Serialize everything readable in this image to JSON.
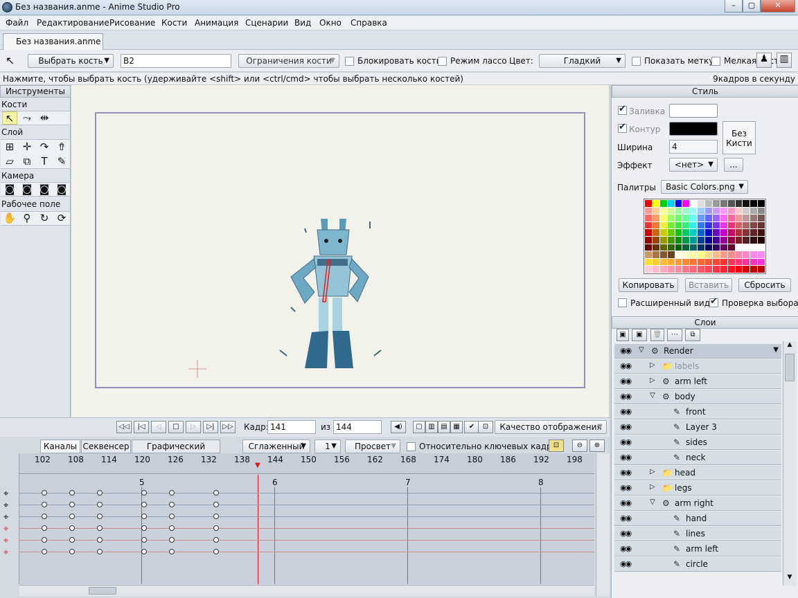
{
  "window": {
    "title": "Без названия.anme - Anime Studio Pro",
    "minimize_glyph": "–",
    "maximize_glyph": "▢",
    "close_glyph": "✕"
  },
  "menu": [
    "Файл",
    "Редактирование",
    "Рисование",
    "Кости",
    "Анимация",
    "Сценарии",
    "Вид",
    "Окно",
    "Справка"
  ],
  "document_tab": "Без названия.anme",
  "toolbar": {
    "mode_dropdown": "Выбрать кость",
    "bone_name": "B2",
    "constraints_button": "Ограничения кости",
    "lock_bone_label": "Блокировать кость",
    "lasso_label": "Режим лассо",
    "color_label": "Цвет:",
    "color_value": "Гладкий",
    "show_label_label": "Показать метку",
    "small_label": "Мелкая кость"
  },
  "status": {
    "hint": "Нажмите, чтобы выбрать кость (удерживайте <shift> или <ctrl/cmd> чтобы выбрать несколько костей)",
    "fps": "9кадров в секунду"
  },
  "tools": {
    "title": "Инструменты",
    "groups": [
      "Кости",
      "Слой",
      "Камера",
      "Рабочее поле"
    ]
  },
  "playback": {
    "frame_label": "Кадр:",
    "frame_value": "141",
    "of_label": "из",
    "total_frames": "144",
    "quality_dropdown": "Качество отображения"
  },
  "timeline": {
    "tabs": [
      "Каналы",
      "Секвенсер",
      "Графический режим"
    ],
    "interp_dropdown": "Сглаженный",
    "step_dropdown": "1",
    "onion_dropdown": "Просвет",
    "relative_label": "Относительно ключевых кадров",
    "ruler_ticks": [
      "102",
      "108",
      "114",
      "120",
      "126",
      "132",
      "138",
      "144",
      "150",
      "156",
      "162",
      "168",
      "174",
      "180",
      "186",
      "192",
      "198"
    ],
    "second_markers": [
      "5",
      "6",
      "7",
      "8"
    ],
    "current_frame": 141
  },
  "style": {
    "title": "Стиль",
    "fill_label": "Заливка",
    "stroke_label": "Контур",
    "no_brush_line1": "Без",
    "no_brush_line2": "Кисти",
    "width_label": "Ширина",
    "width_value": "4",
    "effect_label": "Эффект",
    "effect_value": "<нет>",
    "more_button": "...",
    "palettes_label": "Палитры",
    "palette_value": "Basic Colors.png",
    "copy_button": "Копировать",
    "paste_button": "Вставить",
    "reset_button": "Сбросить",
    "advanced_label": "Расширенный вид",
    "select_check_label": "Проверка выбора",
    "fill_color": "#ffffff",
    "stroke_color": "#000000"
  },
  "layers": {
    "title": "Слои",
    "rows": [
      {
        "name": "Render",
        "type": "bone",
        "indent": 0,
        "expanded": true,
        "head": true
      },
      {
        "name": "labels",
        "type": "folder",
        "indent": 1,
        "expanded": false,
        "dim": true
      },
      {
        "name": "arm left",
        "type": "bone",
        "indent": 1,
        "expanded": false
      },
      {
        "name": "body",
        "type": "bone",
        "indent": 1,
        "expanded": true
      },
      {
        "name": "front",
        "type": "vector",
        "indent": 2
      },
      {
        "name": "Layer 3",
        "type": "vector",
        "indent": 2
      },
      {
        "name": "sides",
        "type": "vector",
        "indent": 2
      },
      {
        "name": "neck",
        "type": "vector",
        "indent": 2
      },
      {
        "name": "head",
        "type": "folder",
        "indent": 1,
        "expanded": false
      },
      {
        "name": "legs",
        "type": "folder",
        "indent": 1,
        "expanded": false
      },
      {
        "name": "arm right",
        "type": "bone",
        "indent": 1,
        "expanded": true
      },
      {
        "name": "hand",
        "type": "vector",
        "indent": 2
      },
      {
        "name": "lines",
        "type": "vector",
        "indent": 2
      },
      {
        "name": "arm left",
        "type": "vector",
        "indent": 2
      },
      {
        "name": "circle",
        "type": "vector",
        "indent": 2
      }
    ]
  }
}
